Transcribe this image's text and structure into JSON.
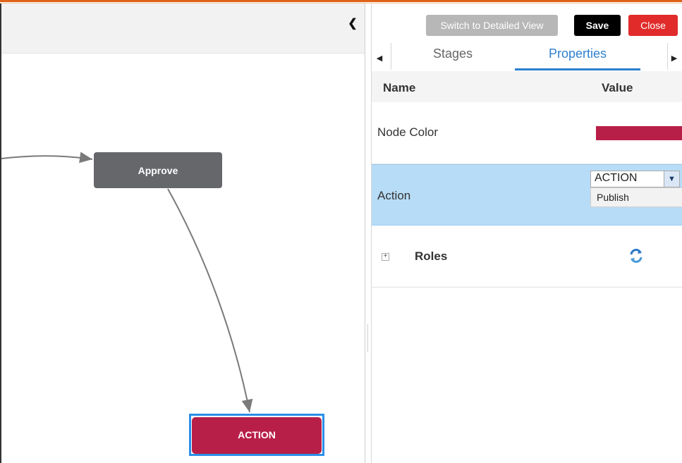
{
  "canvas": {
    "collapse_icon": "chevron-left-icon",
    "nodes": {
      "approve": "Approve",
      "action": "ACTION"
    },
    "colors": {
      "approve": "#66676b",
      "action": "#b81f48",
      "selected_outline": "#2b8fe8"
    }
  },
  "toolbar": {
    "detailed_view_label": "Switch to Detailed View",
    "save_label": "Save",
    "close_label": "Close"
  },
  "tabs": [
    {
      "label": "Stages",
      "active": false
    },
    {
      "label": "Properties",
      "active": true
    }
  ],
  "grid": {
    "headers": {
      "name": "Name",
      "value": "Value"
    },
    "rows": {
      "node_color": {
        "label": "Node Color",
        "color": "#b81f48"
      },
      "action": {
        "label": "Action",
        "selected": "ACTION",
        "options": [
          "Publish"
        ]
      },
      "roles": {
        "label": "Roles"
      }
    }
  }
}
